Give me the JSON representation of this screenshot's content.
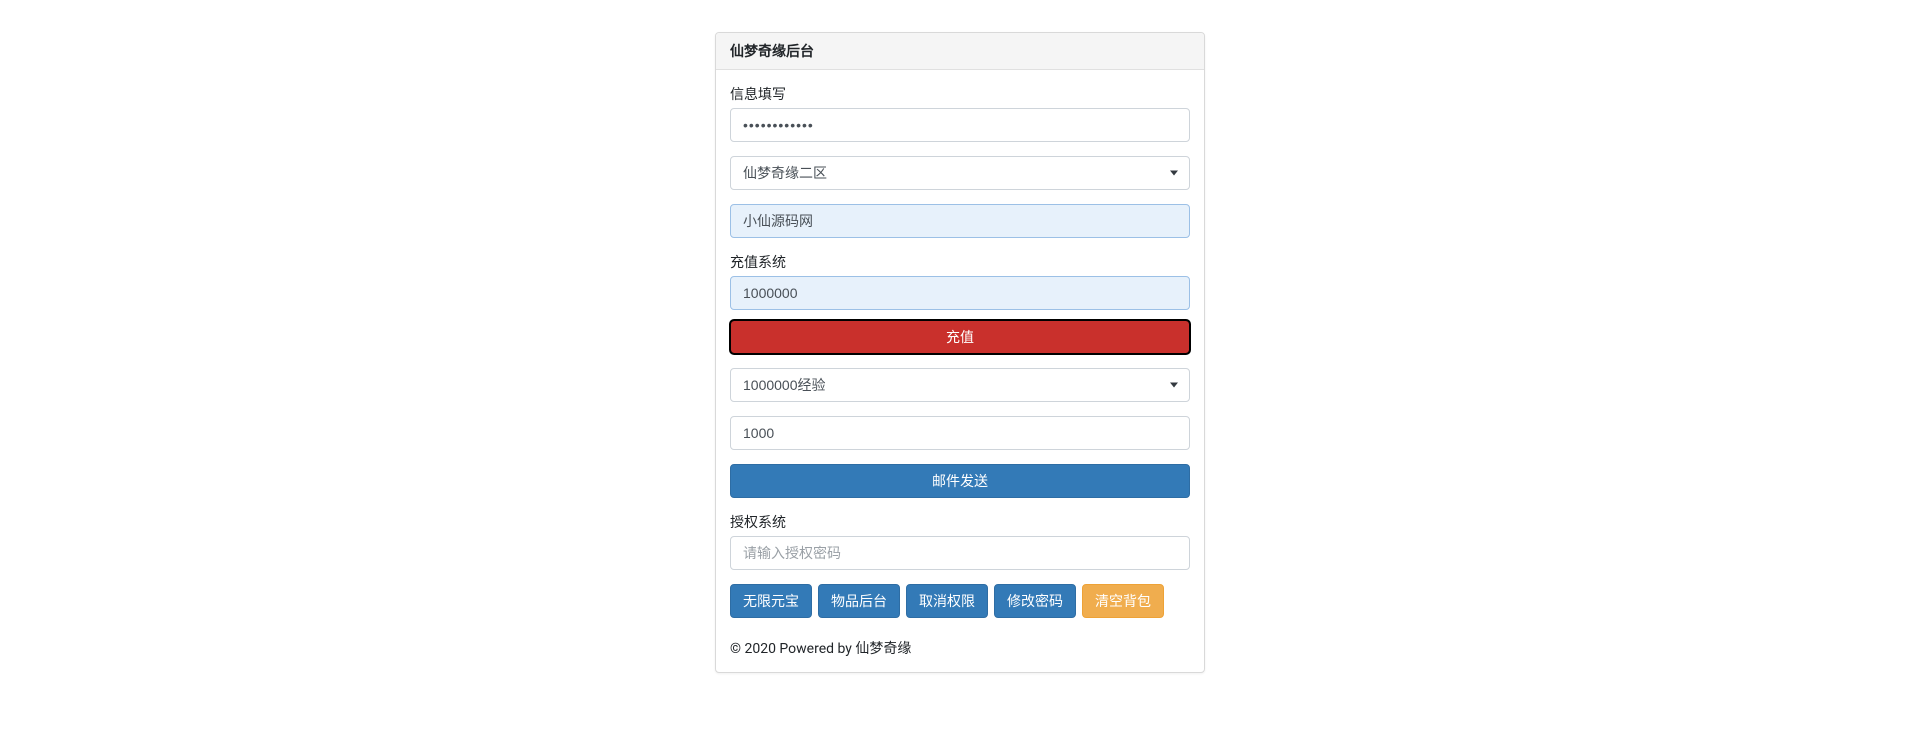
{
  "header": {
    "title": "仙梦奇缘后台"
  },
  "info": {
    "section_label": "信息填写",
    "password_value": "••••••••••••",
    "server_selected": "仙梦奇缘二区",
    "player_name": "小仙源码网"
  },
  "recharge": {
    "section_label": "充值系统",
    "amount_value": "1000000",
    "submit_label": "充值"
  },
  "mail": {
    "item_selected": "1000000经验",
    "qty_value": "1000",
    "send_label": "邮件发送"
  },
  "auth": {
    "section_label": "授权系统",
    "password_placeholder": "请输入授权密码"
  },
  "actions": {
    "unlimited_yuanbao": "无限元宝",
    "item_backend": "物品后台",
    "revoke_auth": "取消权限",
    "change_password": "修改密码",
    "clear_bag": "清空背包"
  },
  "footer": {
    "text": "© 2020 Powered by 仙梦奇缘"
  }
}
